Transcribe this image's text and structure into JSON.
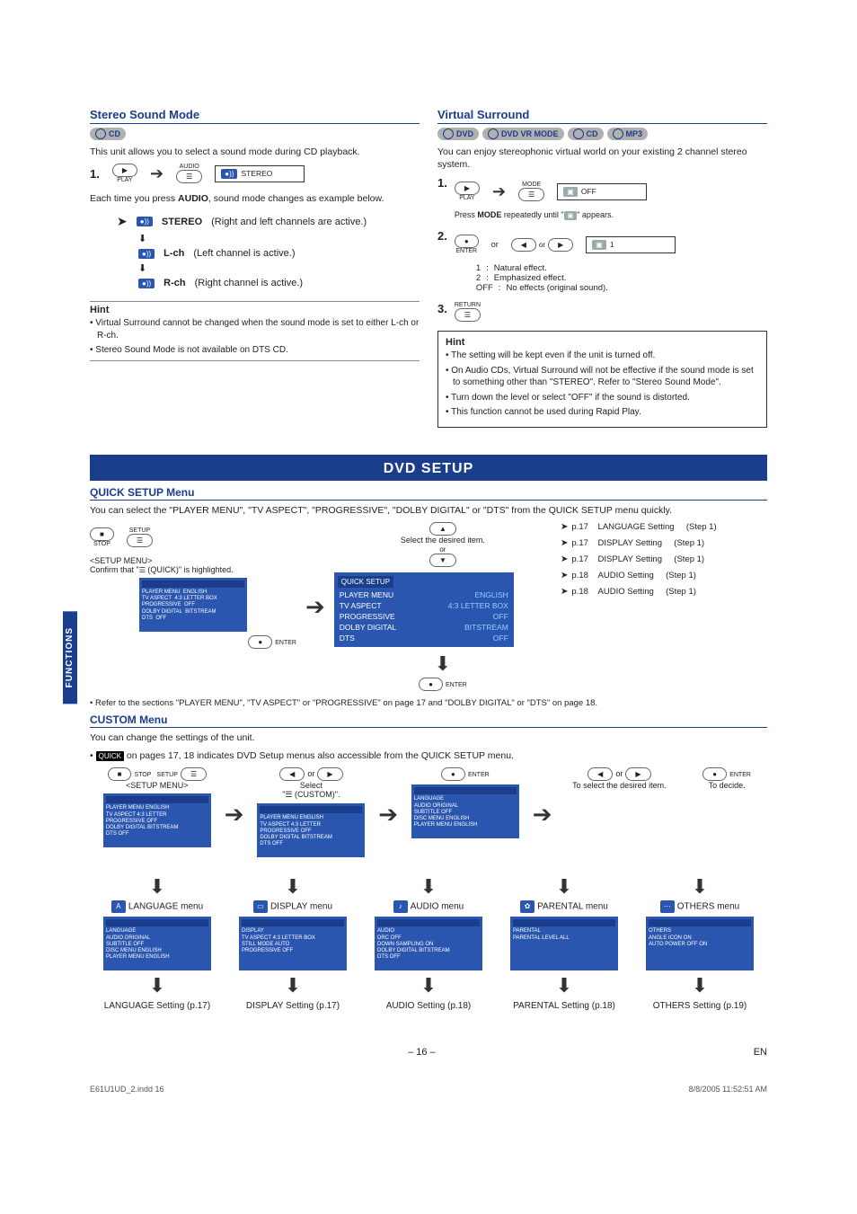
{
  "side_tab": "FUNCTIONS",
  "stereo": {
    "heading": "Stereo Sound Mode",
    "badge": "CD",
    "intro": "This unit allows you to select a sound mode during CD playback.",
    "step1_num": "1.",
    "play_btn": "PLAY",
    "audio_btn": "AUDIO",
    "osd_chip": "STEREO",
    "each_time": "Each time you press AUDIO, sound mode changes as example below.",
    "modes": [
      {
        "chip": "STEREO",
        "label": "STEREO",
        "desc": "(Right and left channels are active.)"
      },
      {
        "chip": "L-ch",
        "label": "L-ch",
        "desc": "(Left channel is active.)"
      },
      {
        "chip": "R-ch",
        "label": "R-ch",
        "desc": "(Right channel is active.)"
      }
    ],
    "hint_title": "Hint",
    "hints": [
      "Virtual Surround cannot be changed when the sound mode is set to either L-ch or R-ch.",
      "Stereo Sound Mode is not available on DTS CD."
    ]
  },
  "virtual": {
    "heading": "Virtual Surround",
    "badges": [
      "DVD",
      "DVD VR MODE",
      "CD",
      "MP3"
    ],
    "intro": "You can enjoy stereophonic virtual world on your existing 2 channel stereo system.",
    "step1_num": "1.",
    "play_btn": "PLAY",
    "mode_btn": "MODE",
    "osd1_label": "OFF",
    "press_mode": "Press MODE repeatedly until \"   \" appears.",
    "step2_num": "2.",
    "enter_btn": "ENTER",
    "or_word": "or",
    "osd2_label": "1",
    "effects": [
      {
        "k": "1",
        "v": "Natural effect."
      },
      {
        "k": "2",
        "v": "Emphasized effect."
      },
      {
        "k": "OFF",
        "v": "No effects (original sound)."
      }
    ],
    "step3_num": "3.",
    "return_btn": "RETURN",
    "hint_title": "Hint",
    "hints": [
      "The setting will be kept even if the unit is turned off.",
      "On Audio CDs, Virtual Surround will not be effective if the sound mode is set to something other than \"STEREO\". Refer to \"Stereo Sound Mode\".",
      "Turn down the level or select \"OFF\" if the sound is distorted.",
      "This function cannot be used during Rapid Play."
    ]
  },
  "dvd_setup_title": "DVD SETUP",
  "quick": {
    "heading": "QUICK SETUP Menu",
    "intro": "You can select the \"PLAYER MENU\", \"TV ASPECT\", \"PROGRESSIVE\", \"DOLBY DIGITAL\" or \"DTS\" from the QUICK SETUP menu quickly.",
    "stop_btn": "STOP",
    "setup_btn": "SETUP",
    "setup_menu_caption": "<SETUP MENU>",
    "confirm_line": "Confirm that \"   (QUICK)\" is highlighted.",
    "enter_btn": "ENTER",
    "select_item": "Select the desired item.",
    "or_word": "or",
    "osd_tab": "QUICK SETUP",
    "osd_rows": [
      {
        "k": "PLAYER MENU",
        "v": "ENGLISH"
      },
      {
        "k": "TV ASPECT",
        "v": "4:3 LETTER BOX"
      },
      {
        "k": "PROGRESSIVE",
        "v": "OFF"
      },
      {
        "k": "DOLBY DIGITAL",
        "v": "BITSTREAM"
      },
      {
        "k": "DTS",
        "v": "OFF"
      }
    ],
    "right_rows": [
      {
        "pg": "p.17",
        "name": "LANGUAGE Setting",
        "step": "(Step 1)"
      },
      {
        "pg": "p.17",
        "name": "DISPLAY Setting",
        "step": "(Step 1)"
      },
      {
        "pg": "p.17",
        "name": "DISPLAY Setting",
        "step": "(Step 1)"
      },
      {
        "pg": "p.18",
        "name": "AUDIO Setting",
        "step": "(Step 1)"
      },
      {
        "pg": "p.18",
        "name": "AUDIO Setting",
        "step": "(Step 1)"
      }
    ],
    "enter_btn2": "ENTER",
    "ref_note": "• Refer to the sections \"PLAYER MENU\", \"TV ASPECT\" or \"PROGRESSIVE\" on page 17 and \"DOLBY DIGITAL\" or \"DTS\" on page 18."
  },
  "custom": {
    "heading": "CUSTOM Menu",
    "intro": "You can change the settings of the unit.",
    "quick_tag": "QUICK",
    "quick_line": " on pages 17, 18 indicates DVD Setup menus also accessible from the QUICK SETUP menu.",
    "stop_btn": "STOP",
    "setup_btn": "SETUP",
    "setup_menu_caption": "<SETUP MENU>",
    "select_custom": "Select \"   (CUSTOM)\".",
    "or_word": "or",
    "enter_btn": "ENTER",
    "to_select": "To select the desired item.",
    "to_decide": "To decide.",
    "menus": [
      {
        "title": "LANGUAGE menu",
        "setting": "LANGUAGE Setting (p.17)"
      },
      {
        "title": "DISPLAY menu",
        "setting": "DISPLAY Setting (p.17)"
      },
      {
        "title": "AUDIO menu",
        "setting": "AUDIO Setting (p.18)"
      },
      {
        "title": "PARENTAL menu",
        "setting": "PARENTAL Setting (p.18)"
      },
      {
        "title": "OTHERS menu",
        "setting": "OTHERS Setting (p.19)"
      }
    ]
  },
  "footer": {
    "page": "– 16 –",
    "lang": "EN"
  },
  "print": {
    "file": "E61U1UD_2.indd   16",
    "stamp": "8/8/2005   11:52:51 AM"
  }
}
